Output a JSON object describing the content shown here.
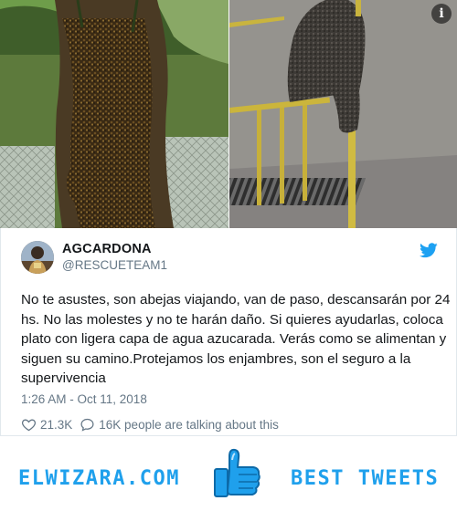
{
  "photos": {
    "left": {
      "alt": "tree-trunk-with-bee-swarm"
    },
    "right": {
      "alt": "bee-swarm-on-yellow-railing"
    },
    "info_icon": "i"
  },
  "tweet": {
    "display_name": "AGCARDONA",
    "handle": "@RESCUETEAM1",
    "text": "No te asustes, son abejas viajando, van de paso, descansarán por 24 hs. No las molestes y no te harán daño. Si quieres ayudarlas, coloca plato con ligera capa de agua azucarada. Verás como se alimentan y siguen su camino.Protejamos los enjambres, son el seguro a la supervivencia",
    "timestamp": "1:26 AM - Oct 11, 2018",
    "likes": "21.3K",
    "talking": "16K people are talking about this"
  },
  "footer": {
    "left_text": "ELWIZARA.COM",
    "right_text": "BEST TWEETS"
  },
  "colors": {
    "twitter_blue": "#1da1f2",
    "footer_blue": "#1fa0ec",
    "text_dark": "#14171a",
    "text_muted": "#657786"
  },
  "icons": [
    "info-icon",
    "twitter-bird-icon",
    "heart-icon",
    "speech-bubble-icon",
    "thumbs-up-icon"
  ]
}
